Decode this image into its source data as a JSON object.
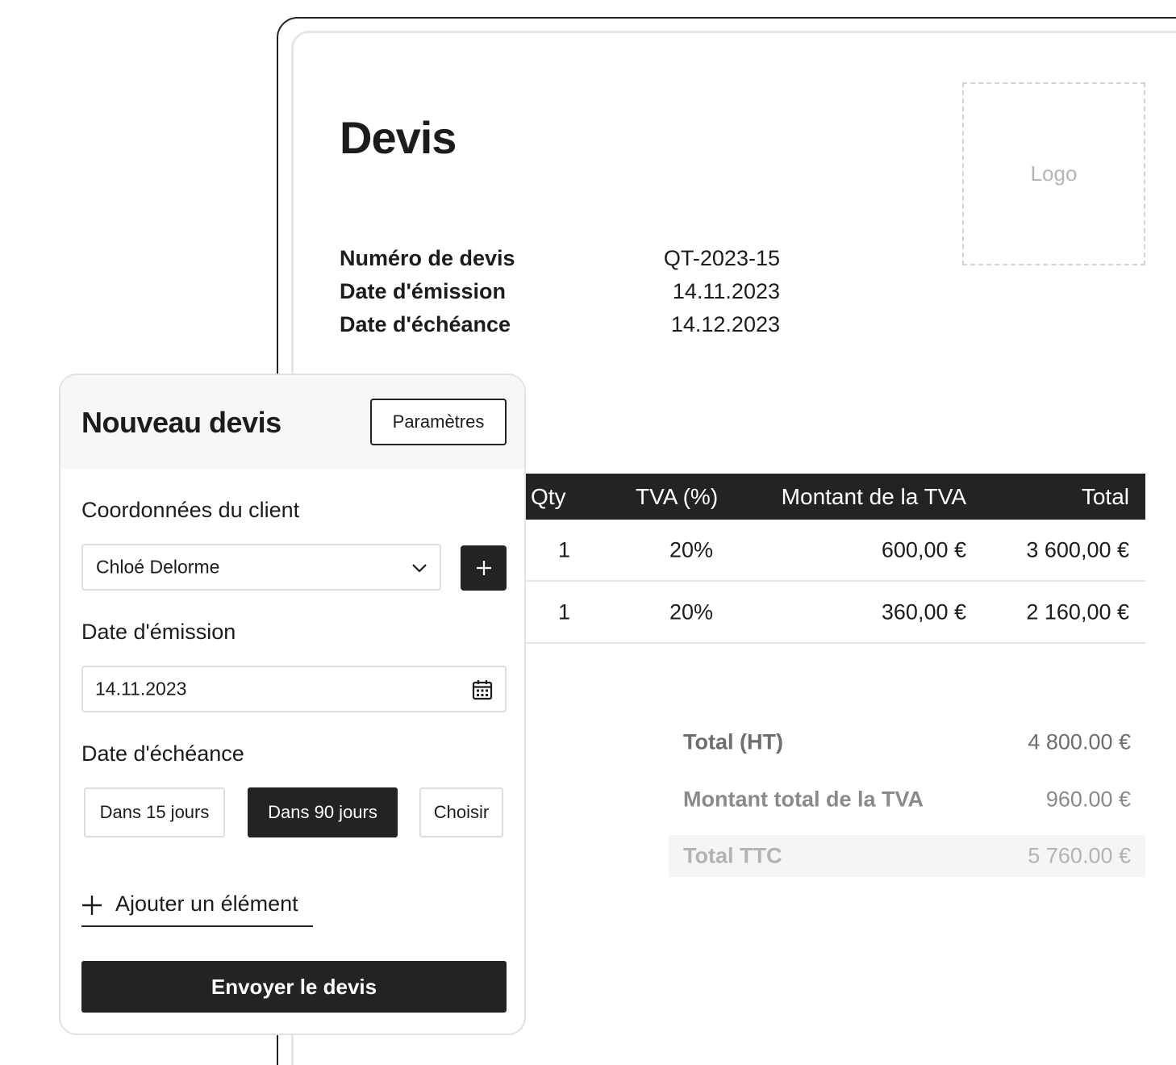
{
  "document": {
    "title": "Devis",
    "logo_placeholder": "Logo",
    "meta": [
      {
        "label": "Numéro de devis",
        "value": "QT-2023-15"
      },
      {
        "label": "Date d'émission",
        "value": "14.11.2023"
      },
      {
        "label": "Date d'échéance",
        "value": "14.12.2023"
      }
    ],
    "table": {
      "columns": [
        "Qty",
        "TVA (%)",
        "Montant de la TVA",
        "Total"
      ],
      "rows": [
        {
          "qty": "1",
          "tva": "20%",
          "montant": "600,00 €",
          "total": "3 600,00 €"
        },
        {
          "qty": "1",
          "tva": "20%",
          "montant": "360,00 €",
          "total": "2 160,00 €"
        }
      ]
    },
    "summary": [
      {
        "label": "Total (HT)",
        "value": "4 800.00 €"
      },
      {
        "label": "Montant total de la TVA",
        "value": "960.00 €"
      },
      {
        "label": "Total TTC",
        "value": "5 760.00 €"
      }
    ]
  },
  "form": {
    "title": "Nouveau devis",
    "settings_label": "Paramètres",
    "client_label": "Coordonnées du client",
    "client_value": "Chloé Delorme",
    "issue_date_label": "Date d'émission",
    "issue_date_value": "14.11.2023",
    "due_date_label": "Date d'échéance",
    "due_options": [
      {
        "label": "Dans 15 jours",
        "selected": false
      },
      {
        "label": "Dans 90 jours",
        "selected": true
      },
      {
        "label": "Choisir",
        "selected": false
      }
    ],
    "add_item_label": "Ajouter un élément",
    "send_label": "Envoyer le devis"
  },
  "icons": {
    "dropdown": "chevron-down-icon",
    "add_client": "plus-icon",
    "calendar": "calendar-icon",
    "add_item": "plus-icon"
  },
  "colors": {
    "primary": "#232323",
    "background": "#ffffff",
    "panel_header": "#f7f7f5",
    "border": "#dedede"
  }
}
